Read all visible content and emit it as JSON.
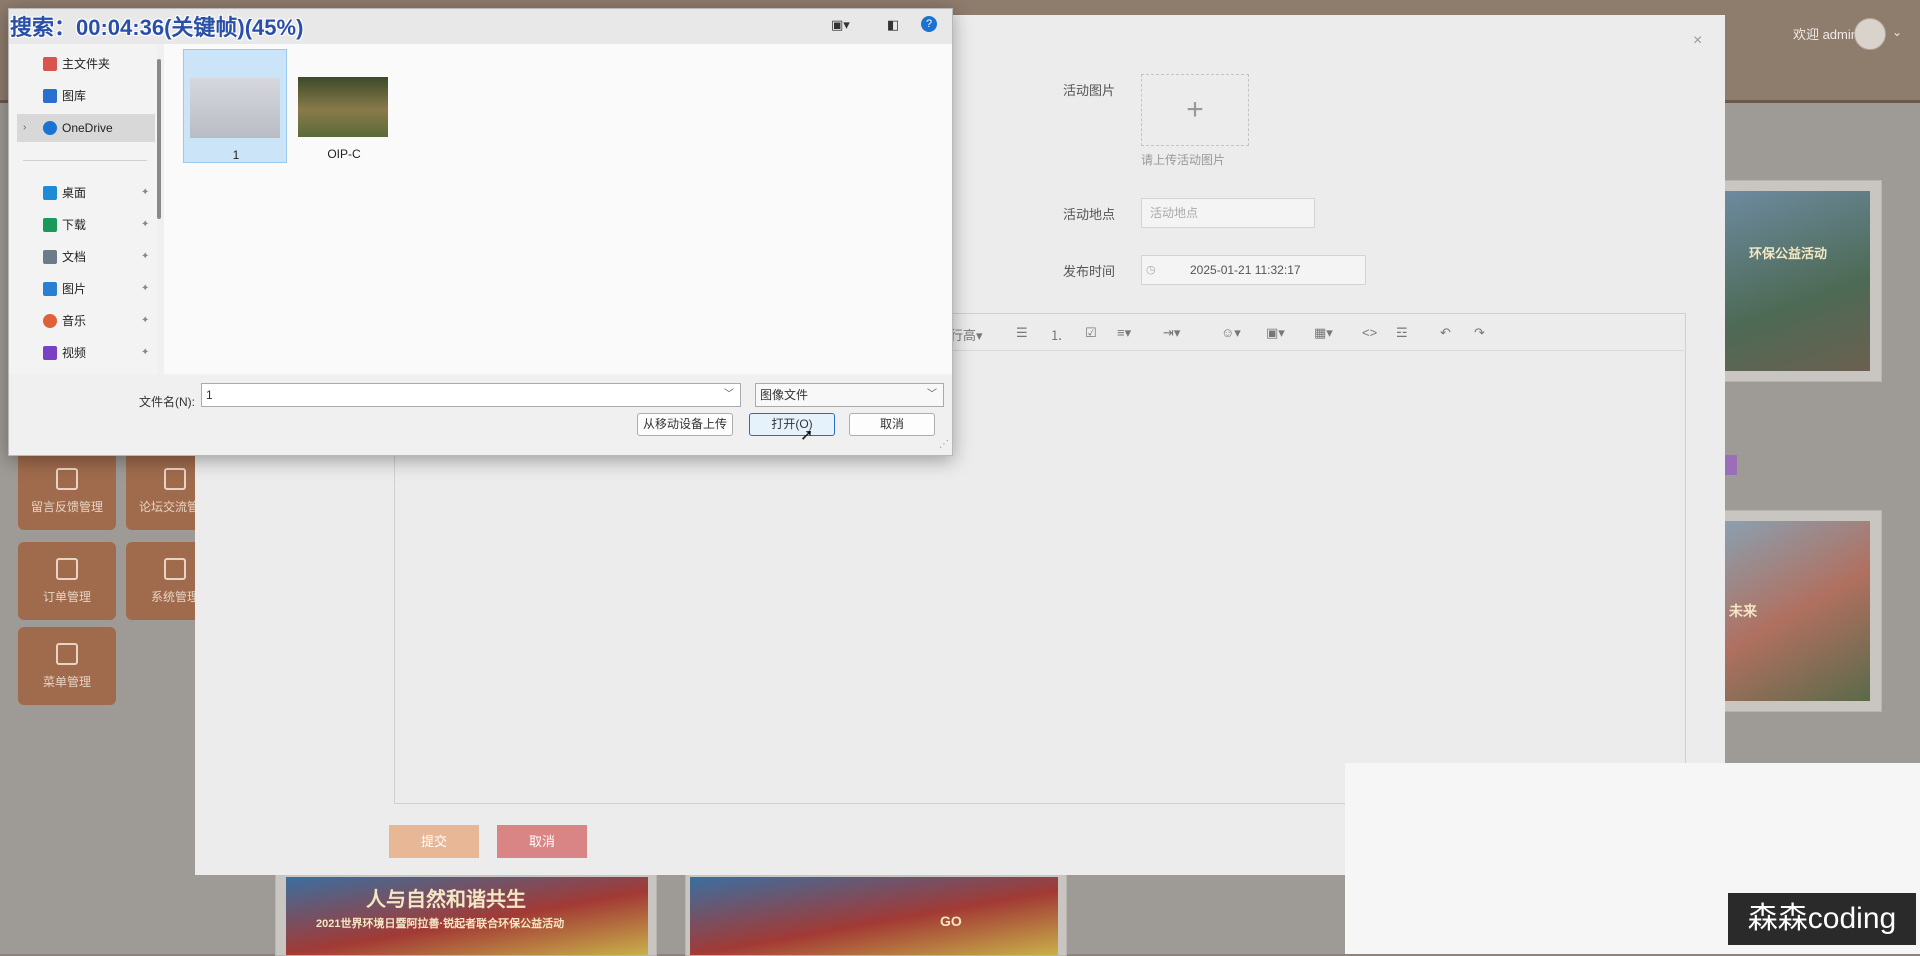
{
  "overlay": {
    "search_status": "搜索：00:04:36(关键帧)(45%)",
    "watermark": "森森coding"
  },
  "header": {
    "welcome": "欢迎 admin"
  },
  "sidebar_tiles": [
    {
      "label": "留言反馈管理"
    },
    {
      "label": "论坛交流管理"
    },
    {
      "label": "订单管理"
    },
    {
      "label": "系统管理"
    },
    {
      "label": "菜单管理"
    }
  ],
  "cards": [
    {
      "caption": "环保公益活动"
    },
    {
      "caption": "未来"
    },
    {
      "caption": "人与自然和谐共生"
    },
    {
      "caption": "2021世界环境日暨阿拉善·锐起者联合环保公益活动"
    },
    {
      "caption": "GO"
    }
  ],
  "form": {
    "image_label": "活动图片",
    "image_plus": "+",
    "image_hint": "请上传活动图片",
    "location_label": "活动地点",
    "location_placeholder": "活动地点",
    "time_label": "发布时间",
    "time_value": "2025-01-21 11:32:17",
    "submit_label": "提交",
    "cancel_label": "取消"
  },
  "editor": {
    "toolbar": [
      "行高▾",
      "☰",
      "⒈",
      "☑",
      "≡▾",
      "⇥▾",
      "☺▾",
      "▣▾",
      "▦▾",
      "<>",
      "☲",
      "↶",
      "↷"
    ]
  },
  "file_dialog": {
    "nav_items": [
      {
        "label": "主文件夹",
        "icon": "home-icon",
        "color": "#d9534f"
      },
      {
        "label": "图库",
        "icon": "gallery-icon",
        "color": "#2a6fd0"
      },
      {
        "label": "OneDrive",
        "icon": "cloud-icon",
        "color": "#1a73d0"
      },
      {
        "label": "桌面",
        "icon": "desktop-icon",
        "color": "#1f8ad6"
      },
      {
        "label": "下载",
        "icon": "download-icon",
        "color": "#1a9a5a"
      },
      {
        "label": "文档",
        "icon": "document-icon",
        "color": "#6c7a89"
      },
      {
        "label": "图片",
        "icon": "pictures-icon",
        "color": "#2a7fd4"
      },
      {
        "label": "音乐",
        "icon": "music-icon",
        "color": "#e0603a"
      },
      {
        "label": "视频",
        "icon": "video-icon",
        "color": "#7b3fc4"
      }
    ],
    "files": [
      {
        "name": "1",
        "selected": true
      },
      {
        "name": "OIP-C",
        "selected": false
      }
    ],
    "filename_label": "文件名(N):",
    "filename_value": "1",
    "filetype_value": "图像文件",
    "upload_mobile_label": "从移动设备上传",
    "open_label": "打开(O)",
    "cancel_label": "取消"
  }
}
